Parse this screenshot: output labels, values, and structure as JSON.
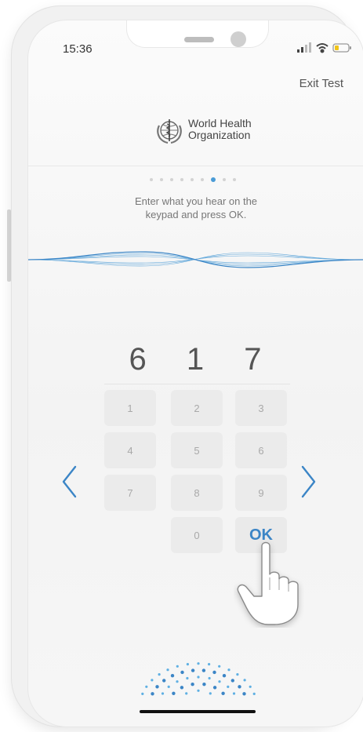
{
  "status_bar": {
    "time": "15:36",
    "icons": [
      "signal-icon",
      "wifi-icon",
      "battery-icon"
    ]
  },
  "header": {
    "exit_label": "Exit Test",
    "logo_line1": "World Health",
    "logo_line2": "Organization"
  },
  "progress": {
    "total_steps": 9,
    "current_step": 7
  },
  "instruction": {
    "line1": "Enter what you hear on the",
    "line2": "keypad and press OK."
  },
  "entry": {
    "digits": "6 1 7"
  },
  "keypad": {
    "keys": [
      "1",
      "2",
      "3",
      "4",
      "5",
      "6",
      "7",
      "8",
      "9",
      "0",
      "OK"
    ]
  },
  "colors": {
    "accent": "#3b85c6",
    "progress_active": "#4a9bd6",
    "key_bg": "#ebebeb"
  }
}
